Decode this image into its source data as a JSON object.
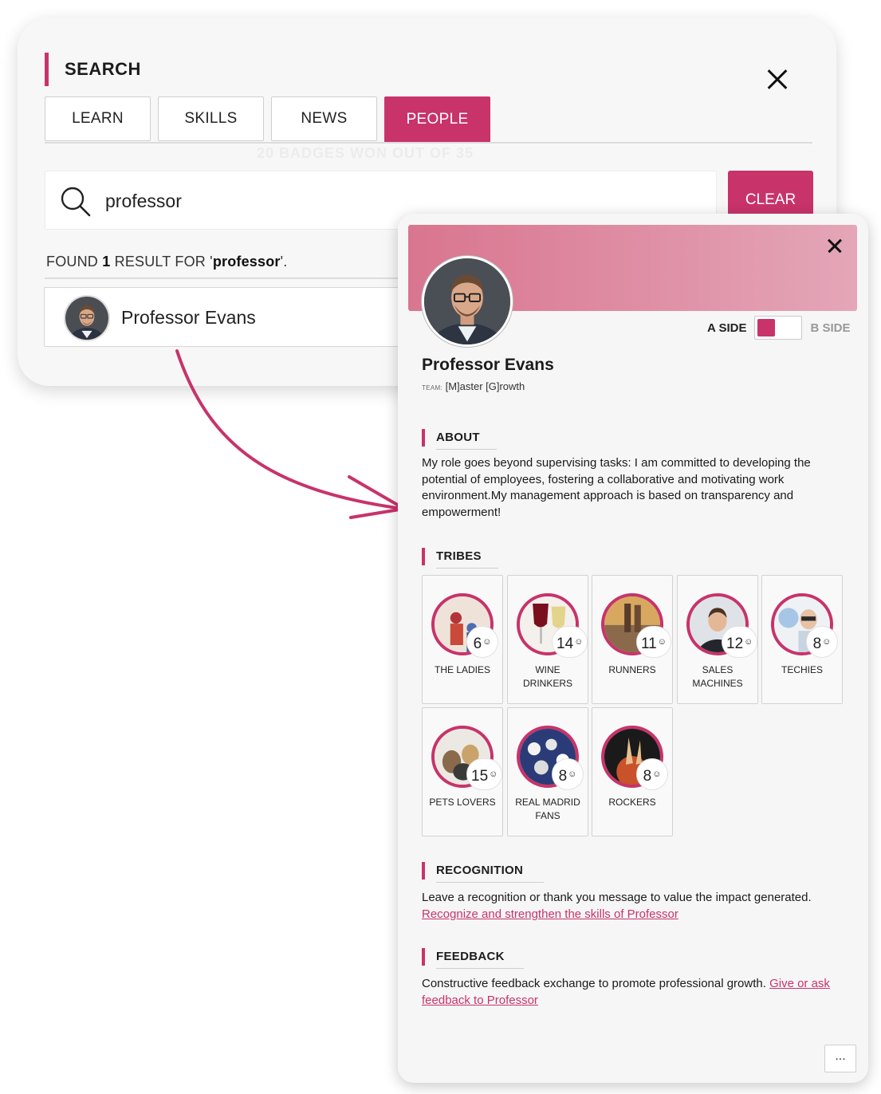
{
  "search": {
    "title": "SEARCH",
    "tabs": [
      {
        "label": "LEARN",
        "active": false
      },
      {
        "label": "SKILLS",
        "active": false
      },
      {
        "label": "NEWS",
        "active": false
      },
      {
        "label": "PEOPLE",
        "active": true
      }
    ],
    "query": "professor",
    "clear_label": "CLEAR",
    "results_prefix": "FOUND ",
    "results_count": "1",
    "results_middle": " RESULT FOR '",
    "results_term": "professor",
    "results_suffix": "'.",
    "results": [
      {
        "name": "Professor Evans",
        "icon": "avatar"
      }
    ],
    "background_ghost_text": "20 BADGES WON OUT OF 35"
  },
  "profile": {
    "name": "Professor Evans",
    "team_label": "TEAM:",
    "team_value": "[M]aster [G]rowth",
    "side_a": "A SIDE",
    "side_b": "B SIDE",
    "side_selected": "A SIDE",
    "about_title": "ABOUT",
    "about_text": "My role goes beyond supervising tasks: I am committed to developing the potential of employees, fostering a collaborative and motivating work environment.My management approach is based on transparency and empowerment!",
    "tribes_title": "TRIBES",
    "tribes": [
      {
        "name": "THE LADIES",
        "count": "6"
      },
      {
        "name": "WINE DRINKERS",
        "count": "14"
      },
      {
        "name": "RUNNERS",
        "count": "11"
      },
      {
        "name": "SALES MACHINES",
        "count": "12"
      },
      {
        "name": "TECHIES",
        "count": "8"
      },
      {
        "name": "PETS LOVERS",
        "count": "15"
      },
      {
        "name": "REAL MADRID FANS",
        "count": "8"
      },
      {
        "name": "ROCKERS",
        "count": "8"
      }
    ],
    "recognition_title": "RECOGNITION",
    "recognition_text": "Leave a recognition or thank you message to value the impact generated.",
    "recognition_link": "Recognize and strengthen the skills of Professor",
    "feedback_title": "FEEDBACK",
    "feedback_text": "Constructive feedback exchange to promote professional growth. ",
    "feedback_link": "Give or ask feedback to Professor",
    "more_label": "..."
  },
  "colors": {
    "accent": "#c8336a",
    "banner_start": "#d9758f",
    "banner_end": "#e4a6b8",
    "panel_bg": "#f7f7f7"
  },
  "icons": {
    "search": "search-icon",
    "close": "close-icon",
    "user": "user-icon",
    "more": "more-icon"
  }
}
